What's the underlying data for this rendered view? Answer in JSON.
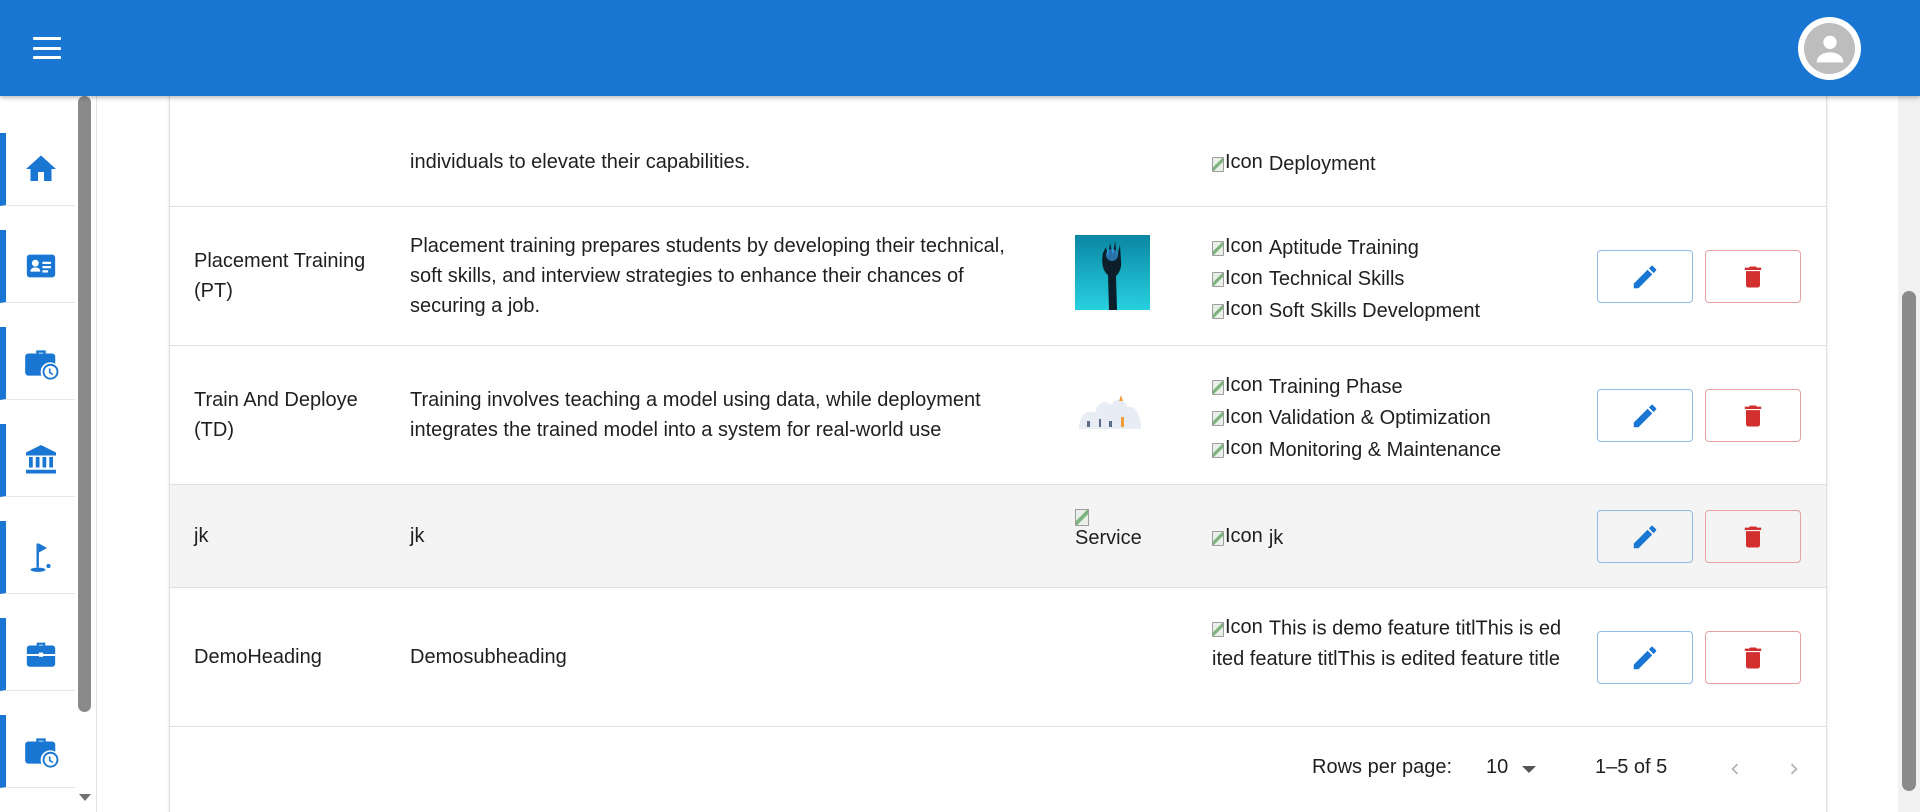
{
  "colors": {
    "primary": "#1976d2",
    "danger": "#d32f2f",
    "appbar": "#1976d2"
  },
  "header": {
    "menu_icon": "menu-icon",
    "avatar_icon": "account-circle-icon"
  },
  "sidebar": {
    "items": [
      {
        "icon": "home-icon"
      },
      {
        "icon": "contact-card-icon"
      },
      {
        "icon": "work-history-icon"
      },
      {
        "icon": "bank-icon"
      },
      {
        "icon": "golf-flag-icon"
      },
      {
        "icon": "briefcase-icon"
      },
      {
        "icon": "work-history-icon"
      }
    ]
  },
  "table": {
    "rows": [
      {
        "title": "",
        "description": "individuals to elevate their capabilities.",
        "features": [
          {
            "alt": "Icon",
            "label": "Deployment"
          }
        ]
      },
      {
        "title": "Placement Training (PT)",
        "description": "Placement training prepares students by developing their technical, soft skills, and interview strategies to enhance their chances of securing a job.",
        "features": [
          {
            "alt": "Icon",
            "label": "Aptitude Training"
          },
          {
            "alt": "Icon",
            "label": "Technical Skills"
          },
          {
            "alt": "Icon",
            "label": "Soft Skills Development"
          }
        ]
      },
      {
        "title": "Train And Deploye (TD)",
        "description": "Training involves teaching a model using data, while deployment integrates the trained model into a system for real-world use",
        "features": [
          {
            "alt": "Icon",
            "label": "Training Phase"
          },
          {
            "alt": "Icon",
            "label": "Validation & Optimization"
          },
          {
            "alt": "Icon",
            "label": "Monitoring & Maintenance"
          }
        ]
      },
      {
        "title": "jk",
        "description": "jk",
        "image_alt": "Service",
        "features": [
          {
            "alt": "Icon",
            "label": "jk"
          }
        ]
      },
      {
        "title": "DemoHeading",
        "description": "Demosubheading",
        "features": [
          {
            "alt": "Icon",
            "label": "This is demo feature titlThis is edited feature titlThis is edited feature title"
          }
        ]
      }
    ]
  },
  "pagination": {
    "rows_per_page_label": "Rows per page:",
    "rows_per_page_value": "10",
    "range": "1–5 of 5"
  }
}
